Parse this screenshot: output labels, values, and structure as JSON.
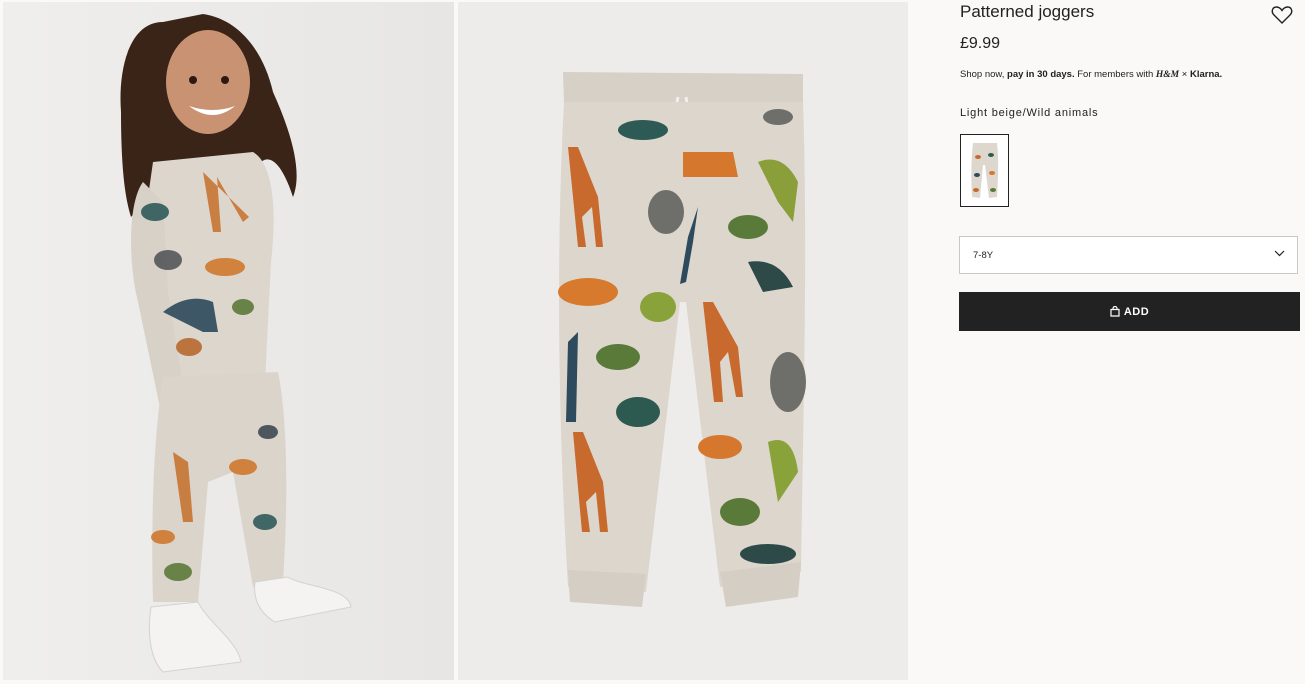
{
  "product": {
    "title": "Patterned joggers",
    "price": "£9.99",
    "klarna": {
      "prefix": "Shop now, ",
      "bold": "pay in 30 days.",
      "suffix": " For members with ",
      "brand": "H&M",
      "times": " × ",
      "partner": "Klarna."
    },
    "color_name": "Light beige/Wild animals",
    "size": "7-8Y",
    "add_label": "ADD"
  },
  "icons": {
    "favorite": "heart-outline-icon",
    "dropdown": "chevron-down-icon",
    "cart": "shopping-bag-icon"
  },
  "colors": {
    "button_bg": "#222222",
    "page_bg": "#faf9f8",
    "fabric": "#dcd6cd"
  }
}
